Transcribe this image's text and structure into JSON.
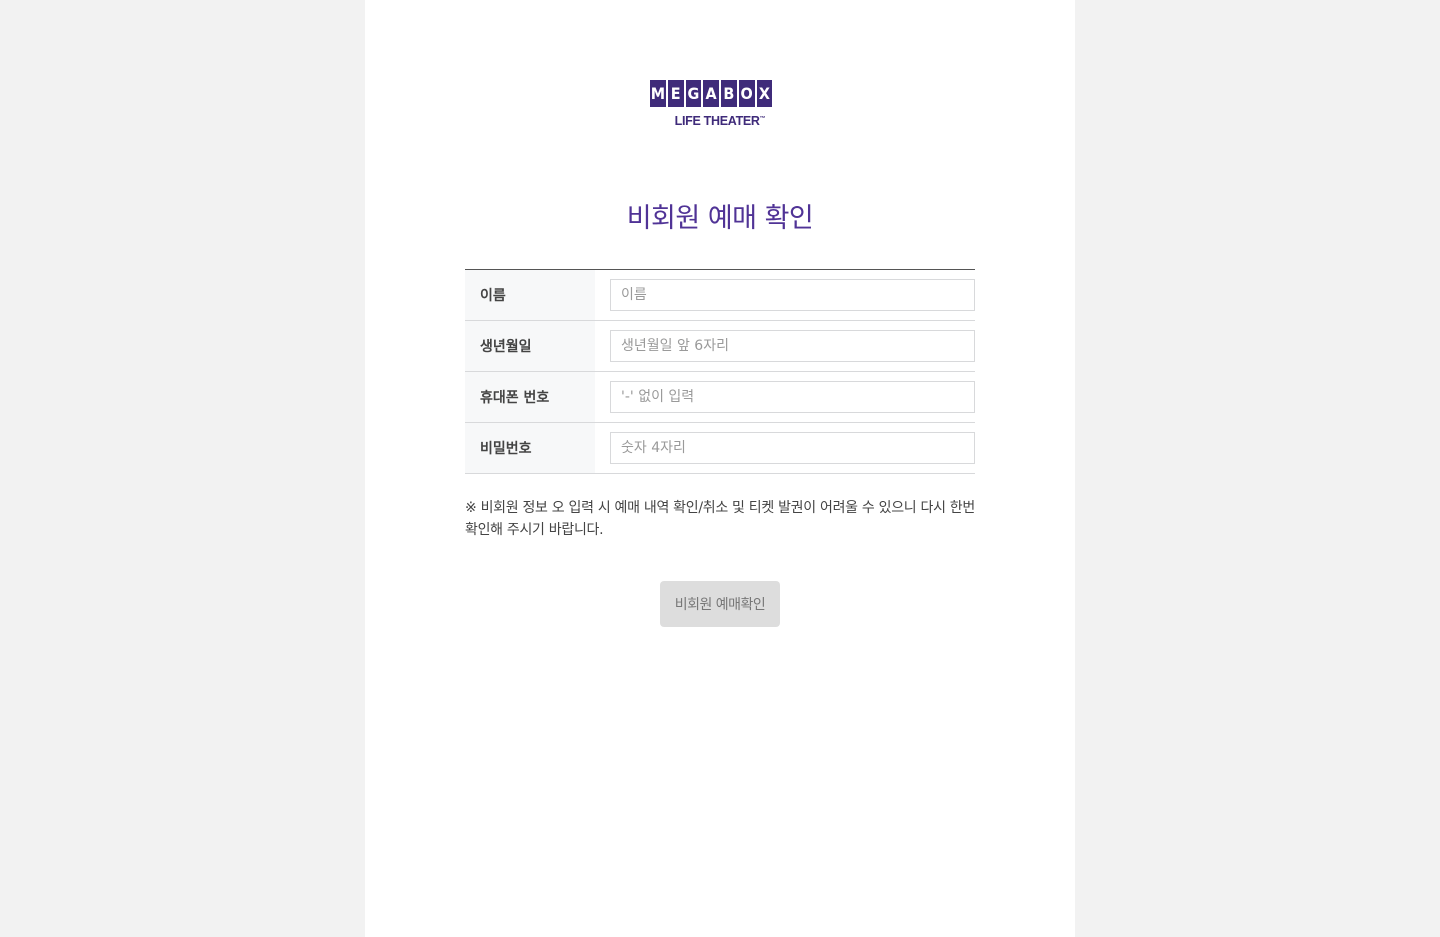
{
  "logo": {
    "letters": [
      "M",
      "E",
      "G",
      "A",
      "B",
      "O",
      "X"
    ],
    "tagline": "LIFE THEATER",
    "trademark": "™",
    "brand_color": "#3f2b7a"
  },
  "page": {
    "title": "비회원 예매 확인",
    "title_color": "#503396",
    "background_color": "#f2f2f2",
    "panel_color": "#ffffff"
  },
  "form": {
    "rows": [
      {
        "label": "이름",
        "placeholder": "이름",
        "value": ""
      },
      {
        "label": "생년월일",
        "placeholder": "생년월일 앞 6자리",
        "value": ""
      },
      {
        "label": "휴대폰 번호",
        "placeholder": "'-' 없이 입력",
        "value": ""
      },
      {
        "label": "비밀번호",
        "placeholder": "숫자 4자리",
        "value": ""
      }
    ]
  },
  "notice": {
    "text": "※ 비회원 정보 오 입력 시 예매 내역 확인/취소 및 티켓 발권이 어려울 수 있으니 다시 한번 확인해 주시기 바랍니다."
  },
  "actions": {
    "confirm_label": "비회원 예매확인",
    "confirm_bg": "#dddddd"
  }
}
